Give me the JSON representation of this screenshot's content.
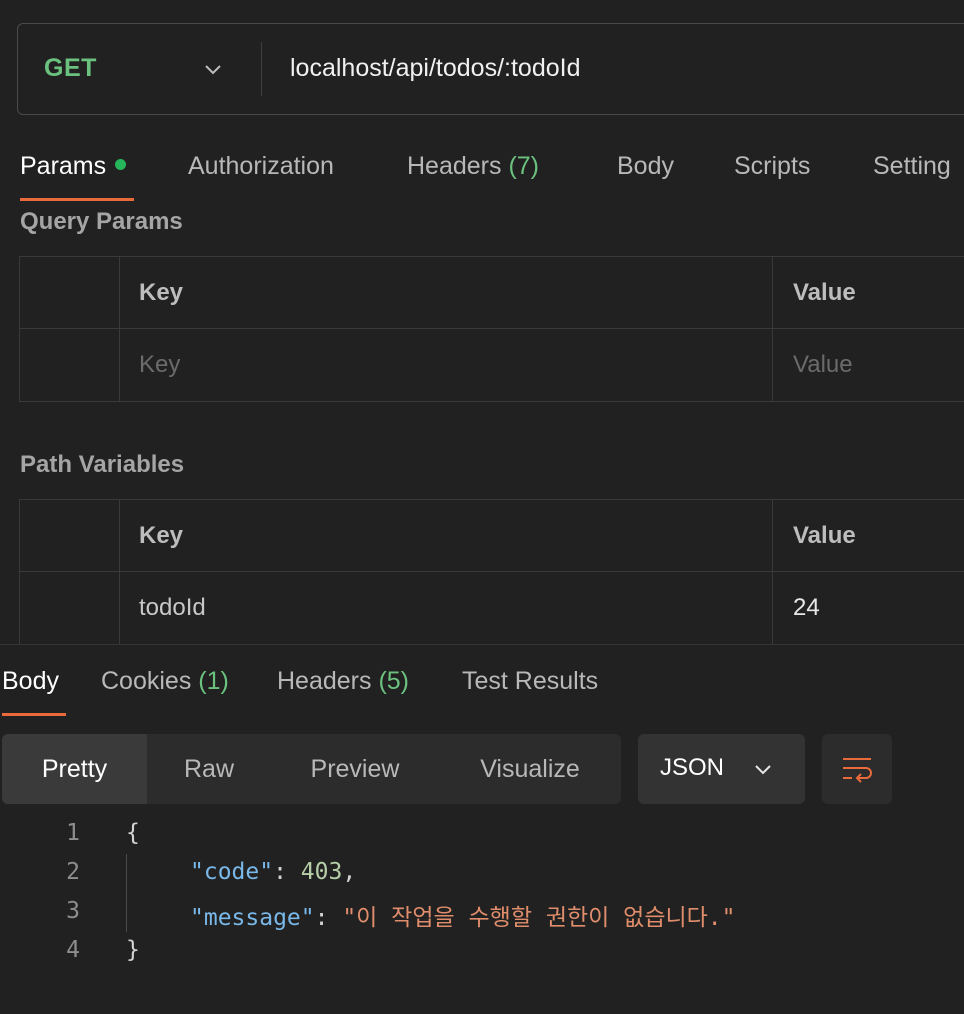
{
  "request": {
    "method": "GET",
    "url": "localhost/api/todos/:todoId"
  },
  "request_tabs": {
    "params": "Params",
    "authorization": "Authorization",
    "headers": "Headers",
    "headers_count": "(7)",
    "body": "Body",
    "scripts": "Scripts",
    "settings": "Setting"
  },
  "query_params": {
    "title": "Query Params",
    "key_header": "Key",
    "value_header": "Value",
    "key_placeholder": "Key",
    "value_placeholder": "Value"
  },
  "path_variables": {
    "title": "Path Variables",
    "key_header": "Key",
    "value_header": "Value",
    "rows": [
      {
        "key": "todoId",
        "value": "24"
      }
    ]
  },
  "response_tabs": {
    "body": "Body",
    "cookies": "Cookies",
    "cookies_count": "(1)",
    "headers": "Headers",
    "headers_count": "(5)",
    "test_results": "Test Results"
  },
  "view_modes": {
    "pretty": "Pretty",
    "raw": "Raw",
    "preview": "Preview",
    "visualize": "Visualize"
  },
  "format": {
    "selected": "JSON"
  },
  "response_body": {
    "line_numbers": [
      "1",
      "2",
      "3",
      "4"
    ],
    "open_brace": "{",
    "close_brace": "}",
    "code_key": "\"code\"",
    "code_value": "403",
    "message_key": "\"message\"",
    "message_value": "\"이 작업을 수행할 권한이 없습니다.\"",
    "colon": ": ",
    "comma": ","
  },
  "colors": {
    "accent": "#e96a3a",
    "method_get": "#6bc27f",
    "status_dot": "#26b55a"
  }
}
